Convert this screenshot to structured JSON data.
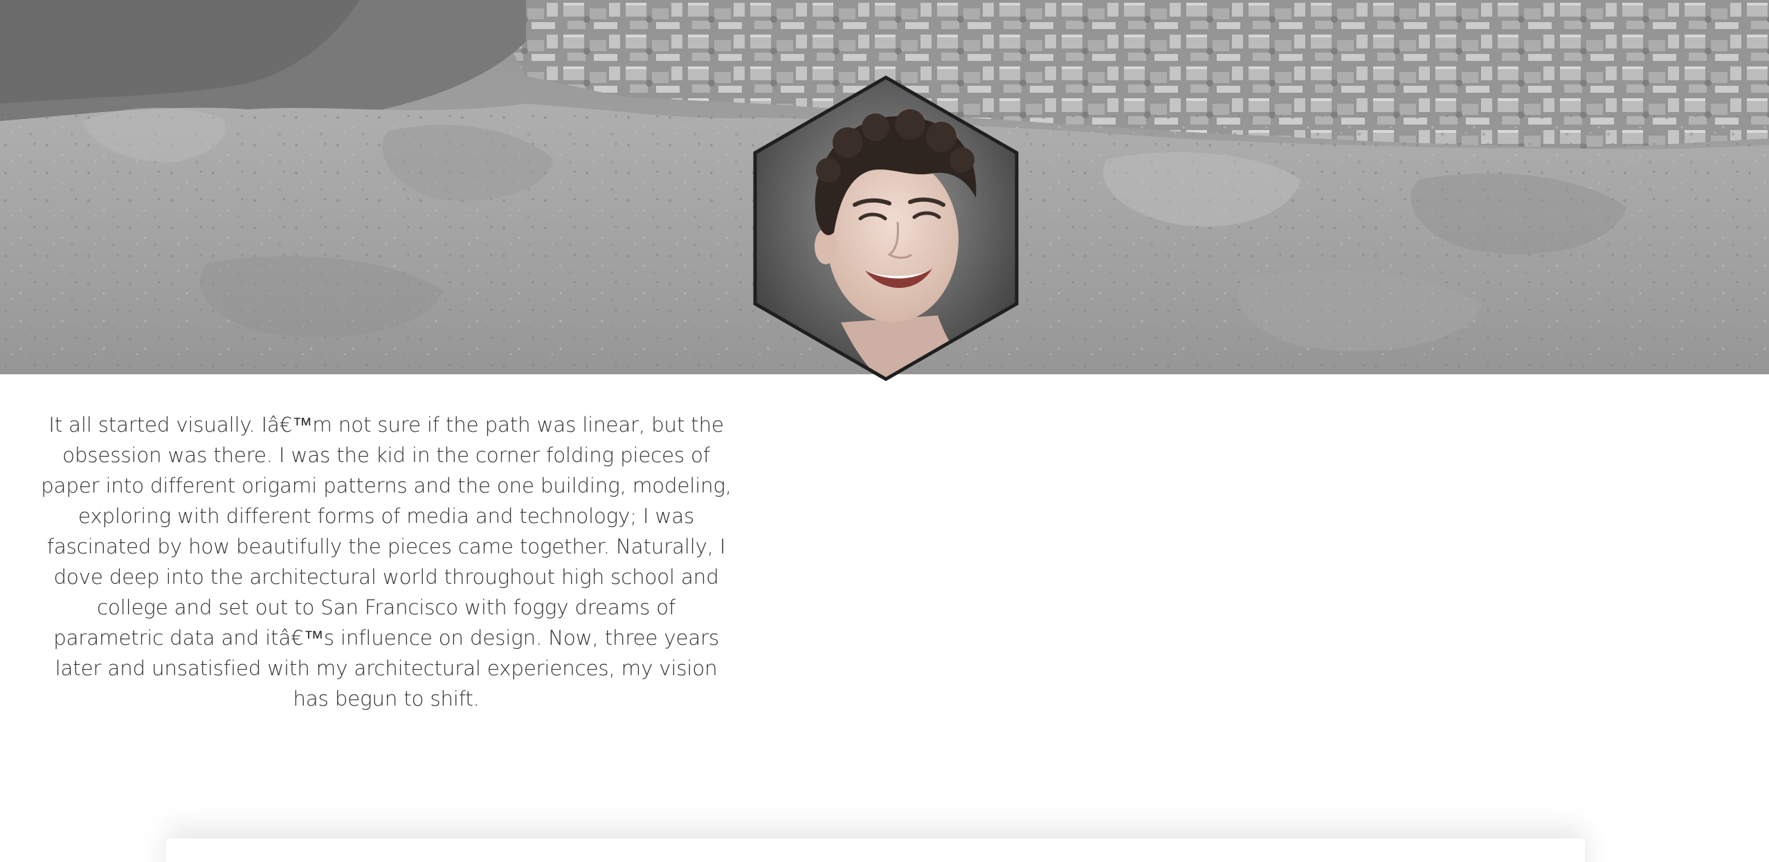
{
  "hero": {
    "image": "grayscale-hillside-overlooking-city",
    "tint": "#9a9a9a"
  },
  "avatar": {
    "image": "smiling-person-portrait",
    "shape": "hexagon",
    "border_color": "#1f1f1f"
  },
  "bio": {
    "text": "It all started visually. Iâ€™m not sure if the path was linear, but the obsession was there. I was the kid in the corner folding pieces of paper into different origami patterns and the one building, modeling, exploring with different forms of media and technology; I was fascinated by how beautifully the pieces came together. Naturally, I dove deep into the architectural world throughout high school and college and set out to San Francisco with foggy dreams of parametric data and itâ€™s influence on design. Now, three years later and unsatisfied with my architectural experiences, my vision has begun to shift."
  },
  "colors": {
    "text": "#333333",
    "background": "#ffffff"
  }
}
